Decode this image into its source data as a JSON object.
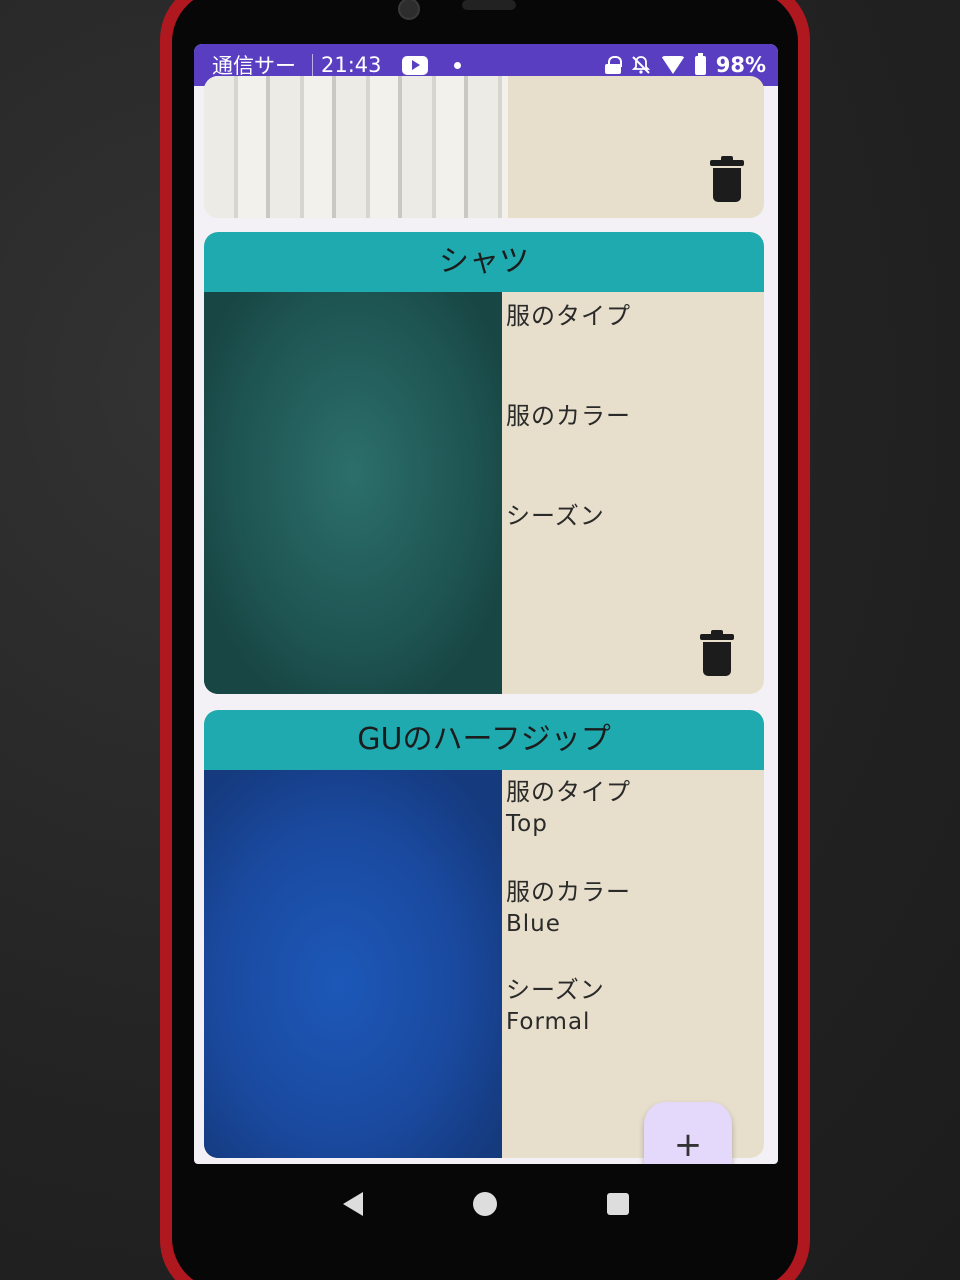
{
  "status_bar": {
    "carrier": "通信サー",
    "time": "21:43",
    "battery": "98%",
    "icons": [
      "youtube-icon",
      "dot-icon",
      "lock-icon",
      "bell-off-icon",
      "wifi-icon",
      "battery-icon"
    ]
  },
  "cards": [
    {
      "title": "",
      "photo": "white-clothes-photo"
    },
    {
      "title": "シャツ",
      "photo": "green-sweatshirt-photo",
      "fields": [
        {
          "label": "服のタイプ",
          "value": ""
        },
        {
          "label": "服のカラー",
          "value": ""
        },
        {
          "label": "シーズン",
          "value": ""
        }
      ]
    },
    {
      "title": "GUのハーフジップ",
      "photo": "blue-half-zip-photo",
      "fields": [
        {
          "label": "服のタイプ",
          "value": "Top"
        },
        {
          "label": "服のカラー",
          "value": "Blue"
        },
        {
          "label": "シーズン",
          "value": "Formal"
        }
      ]
    }
  ],
  "fab": {
    "label": "+"
  },
  "colors": {
    "status_bar": "#5a3ec2",
    "card_header": "#1faab0",
    "card_body": "#e7dfcb",
    "fab": "#e4d8fb"
  }
}
